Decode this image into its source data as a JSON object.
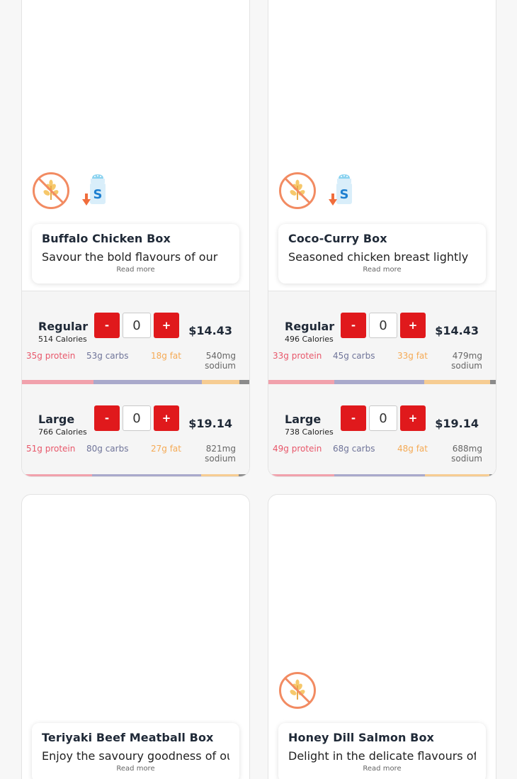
{
  "products": [
    {
      "name": "Buffalo Chicken Box",
      "description": "Savour the bold flavours of our",
      "read_more": "Read more",
      "badges": [
        "gluten-free-icon",
        "low-sodium-icon"
      ],
      "sizes": [
        {
          "name": "Regular",
          "calories": "514 Calories",
          "qty": "0",
          "price": "$14.43",
          "protein": "35g protein",
          "carbs": "53g carbs",
          "fat": "18g fat",
          "sodium": "540mg sodium",
          "bar": [
            35,
            53,
            18,
            5
          ]
        },
        {
          "name": "Large",
          "calories": "766 Calories",
          "qty": "0",
          "price": "$19.14",
          "protein": "51g protein",
          "carbs": "80g carbs",
          "fat": "27g fat",
          "sodium": "821mg sodium",
          "bar": [
            51,
            80,
            27,
            8
          ]
        }
      ]
    },
    {
      "name": "Coco-Curry Box",
      "description": "Seasoned chicken breast lightly",
      "read_more": "Read more",
      "badges": [
        "gluten-free-icon",
        "low-sodium-icon"
      ],
      "sizes": [
        {
          "name": "Regular",
          "calories": "496 Calories",
          "qty": "0",
          "price": "$14.43",
          "protein": "33g protein",
          "carbs": "45g carbs",
          "fat": "33g fat",
          "sodium": "479mg sodium",
          "bar": [
            33,
            45,
            33,
            3
          ]
        },
        {
          "name": "Large",
          "calories": "738 Calories",
          "qty": "0",
          "price": "$19.14",
          "protein": "49g protein",
          "carbs": "68g carbs",
          "fat": "48g fat",
          "sodium": "688mg sodium",
          "bar": [
            49,
            68,
            48,
            5
          ]
        }
      ]
    },
    {
      "name": "Teriyaki Beef Meatball Box",
      "description": "Enjoy the savoury goodness of our",
      "read_more": "Read more",
      "badges": []
    },
    {
      "name": "Honey Dill Salmon Box",
      "description": "Delight in the delicate flavours of",
      "read_more": "Read more",
      "badges": [
        "gluten-free-icon"
      ]
    }
  ],
  "buttons": {
    "minus": "-",
    "plus": "+"
  },
  "colors": {
    "accent": "#e0191c",
    "protein": "#e8576a",
    "carbs": "#6f7499",
    "fat": "#f5aa55",
    "sodium": "#666666"
  }
}
